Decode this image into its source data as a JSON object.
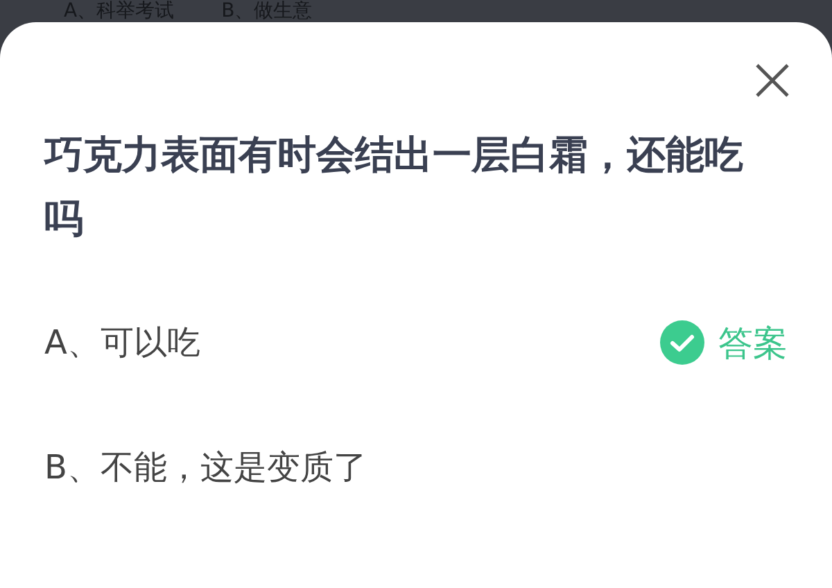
{
  "background": {
    "options": [
      "A、科举考试",
      "B、做生意"
    ]
  },
  "sheet": {
    "question": "巧克力表面有时会结出一层白霜，还能吃吗",
    "answer_label": "答案",
    "options": [
      {
        "text": "A、可以吃",
        "correct": true
      },
      {
        "text": "B、不能，这是变质了",
        "correct": false
      }
    ]
  }
}
